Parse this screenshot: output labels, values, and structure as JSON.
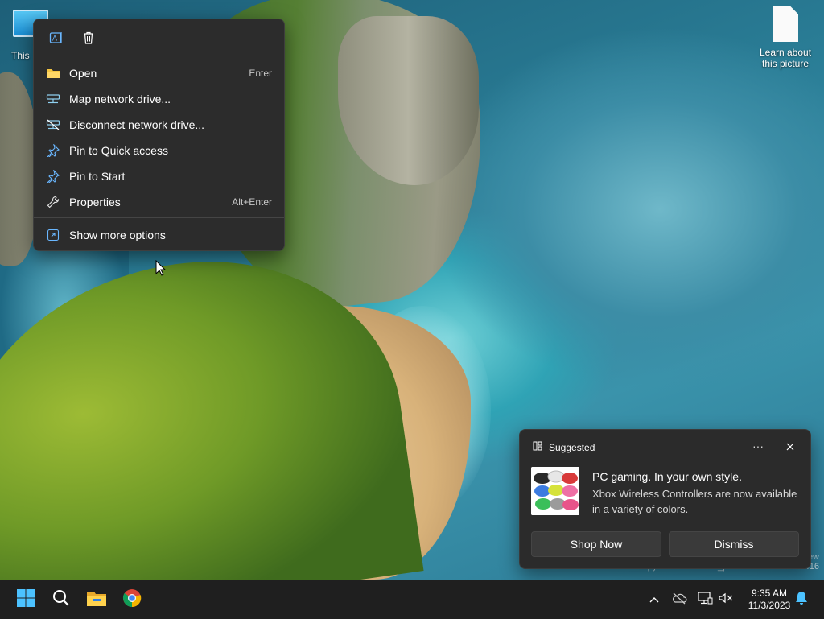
{
  "desktop": {
    "icons": [
      {
        "label": "This"
      },
      {
        "label": "Learn about this picture"
      }
    ],
    "watermark_line1": "ew",
    "watermark_line2": "...aluation copy. Build 25947.rs_prerelease.230901-1416"
  },
  "context_menu": {
    "quick_actions": [
      "copilot-icon",
      "trash-icon"
    ],
    "items": [
      {
        "label": "Open",
        "shortcut": "Enter",
        "icon": "folder-icon"
      },
      {
        "label": "Map network drive...",
        "shortcut": "",
        "icon": "map-drive-icon"
      },
      {
        "label": "Disconnect network drive...",
        "shortcut": "",
        "icon": "disconnect-drive-icon"
      },
      {
        "label": "Pin to Quick access",
        "shortcut": "",
        "icon": "pin-icon"
      },
      {
        "label": "Pin to Start",
        "shortcut": "",
        "icon": "pin-icon"
      },
      {
        "label": "Properties",
        "shortcut": "Alt+Enter",
        "icon": "wrench-icon"
      },
      {
        "label": "Show more options",
        "shortcut": "",
        "icon": "show-more-icon"
      }
    ]
  },
  "notification": {
    "header": "Suggested",
    "more_label": "···",
    "title": "PC gaming. In your own style.",
    "body": "Xbox Wireless Controllers are now available in a variety of colors.",
    "primary_button": "Shop Now",
    "secondary_button": "Dismiss"
  },
  "taskbar": {
    "apps": [
      "windows-start-icon",
      "search-icon",
      "file-explorer-icon",
      "chrome-icon"
    ],
    "tray": [
      "chevron-up-icon",
      "onedrive-offline-icon",
      "network-icon",
      "volume-muted-icon",
      "bell-icon"
    ],
    "time": "9:35 AM",
    "date": "11/3/2023"
  },
  "colors": {
    "menu_bg": "#2c2c2c",
    "taskbar_bg": "#1f1f1f",
    "accent": "#4cc2ff"
  }
}
